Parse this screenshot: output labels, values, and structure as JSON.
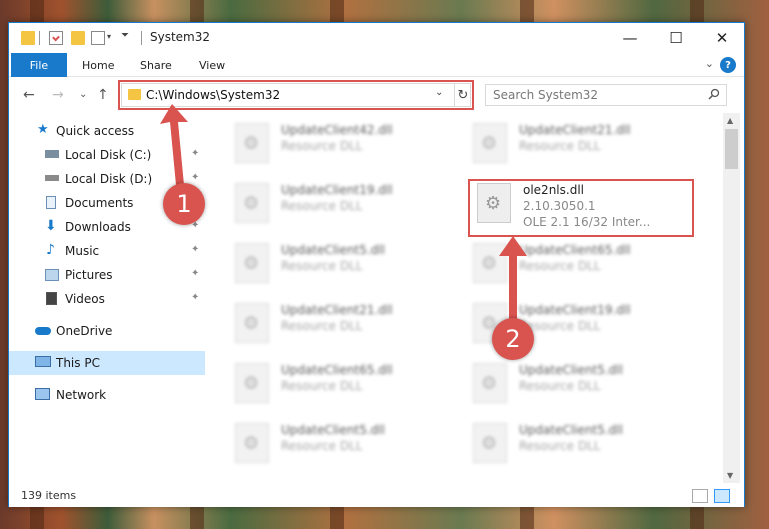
{
  "titlebar": {
    "title": "System32",
    "minimize": "—",
    "maximize": "☐",
    "close": "✕"
  },
  "ribbon": {
    "file": "File",
    "home": "Home",
    "share": "Share",
    "view": "View",
    "help": "?",
    "expand": "⌄"
  },
  "address": {
    "path": "C:\\Windows\\System32",
    "dropdown": "⌄",
    "refresh": "↻",
    "search_placeholder": "Search System32"
  },
  "nav": {
    "back": "←",
    "forward": "→",
    "recent": "⌄",
    "up": "↑"
  },
  "sidebar": {
    "items": [
      {
        "label": "Quick access",
        "icon": "star-icon",
        "pinned": false
      },
      {
        "label": "Local Disk (C:)",
        "icon": "drive-icon",
        "pinned": true
      },
      {
        "label": "Local Disk (D:)",
        "icon": "drive-icon",
        "pinned": true
      },
      {
        "label": "Documents",
        "icon": "documents-icon",
        "pinned": true
      },
      {
        "label": "Downloads",
        "icon": "download-icon",
        "pinned": true
      },
      {
        "label": "Music",
        "icon": "music-icon",
        "pinned": true
      },
      {
        "label": "Pictures",
        "icon": "pictures-icon",
        "pinned": true
      },
      {
        "label": "Videos",
        "icon": "videos-icon",
        "pinned": true
      },
      {
        "label": "OneDrive",
        "icon": "cloud-icon",
        "pinned": false
      },
      {
        "label": "This PC",
        "icon": "computer-icon",
        "pinned": false
      },
      {
        "label": "Network",
        "icon": "network-icon",
        "pinned": false
      }
    ],
    "pin_glyph": "📌"
  },
  "files": {
    "left": [
      {
        "name": "UpdateClient42.dll",
        "type": "Resource DLL"
      },
      {
        "name": "UpdateClient19.dll",
        "type": "Resource DLL"
      },
      {
        "name": "UpdateClient5.dll",
        "type": "Resource DLL"
      },
      {
        "name": "UpdateClient21.dll",
        "type": "Resource DLL"
      },
      {
        "name": "UpdateClient65.dll",
        "type": "Resource DLL"
      },
      {
        "name": "UpdateClient5.dll",
        "type": "Resource DLL"
      }
    ],
    "right": [
      {
        "name": "UpdateClient21.dll",
        "type": "Resource DLL"
      },
      {
        "name": "ole2nls.dll",
        "version": "2.10.3050.1",
        "type": "OLE 2.1 16/32 Inter...",
        "highlighted": true
      },
      {
        "name": "UpdateClient65.dll",
        "type": "Resource DLL"
      },
      {
        "name": "UpdateClient19.dll",
        "type": "Resource DLL"
      },
      {
        "name": "UpdateClient5.dll",
        "type": "Resource DLL"
      },
      {
        "name": "UpdateClient5.dll",
        "type": "Resource DLL"
      }
    ]
  },
  "status": {
    "item_count": "139 items"
  },
  "annotations": {
    "step1": "1",
    "step2": "2",
    "color": "#d9534f"
  },
  "colors": {
    "accent": "#1979ca",
    "selected": "#cce8ff"
  }
}
